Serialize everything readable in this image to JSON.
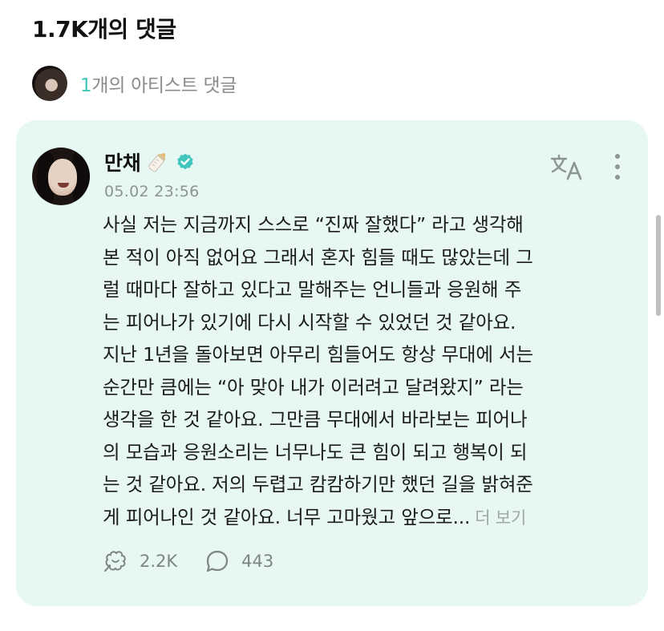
{
  "header": {
    "title": "1.7K개의 댓글"
  },
  "artist_comments": {
    "count": "1",
    "label": "개의 아티스트 댓글"
  },
  "comment": {
    "author": "만채",
    "timestamp": "05.02 23:56",
    "icons": {
      "badge": "baby-bottle-icon",
      "verified": "verified-check-icon",
      "translate": "translate-icon",
      "more": "more-vertical-icon"
    },
    "lines": [
      "사실 저는 지금까지 스스로 “진짜 잘했다” 라고 생각해",
      "본 적이 아직 없어요 그래서 혼자 힘들 때도 많았는데 그",
      "럴 때마다 잘하고 있다고 말해주는 언니들과 응원해 주",
      "는 피어나가 있기에 다시 시작할 수 있었던 것 같아요.",
      "지난 1년을 돌아보면 아무리 힘들어도 항상 무대에 서는",
      "순간만 큼에는 “아 맞아 내가 이러려고 달려왔지” 라는",
      "생각을 한 것 같아요. 그만큼 무대에서 바라보는 피어나",
      "의 모습과 응원소리는 너무나도 큰 힘이 되고 행복이 되",
      "는 것 같아요. 저의 두렵고 캄캄하기만 했던 길을 밝혀준",
      "게 피어나인 것 같아요. 너무 고마웠고 앞으로..."
    ],
    "more_label": "더 보기",
    "likes": "2.2K",
    "replies": "443"
  },
  "colors": {
    "accent": "#3fc6bd",
    "card_bg": "#e7f8f4",
    "muted": "#8b8b8b"
  }
}
